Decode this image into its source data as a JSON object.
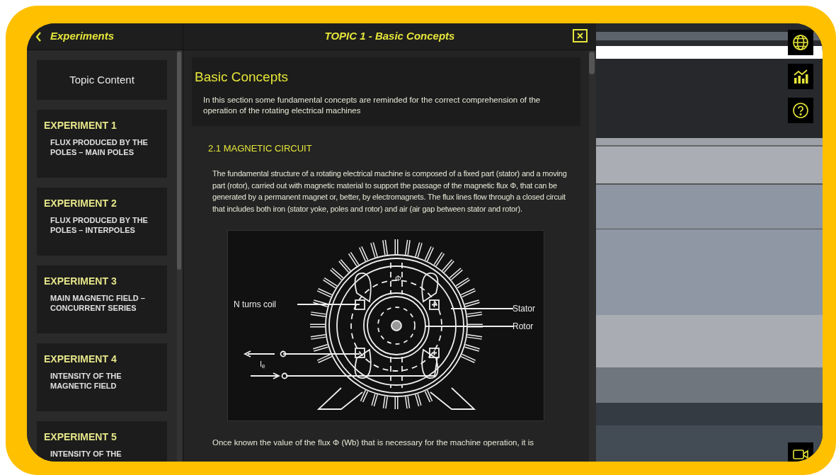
{
  "sidebar": {
    "back_label": "Experiments",
    "topic_content": "Topic Content",
    "items": [
      {
        "title": "EXPERIMENT 1",
        "subtitle": "FLUX PRODUCED BY THE POLES – MAIN POLES"
      },
      {
        "title": "EXPERIMENT 2",
        "subtitle": "FLUX PRODUCED BY THE POLES – INTERPOLES"
      },
      {
        "title": "EXPERIMENT 3",
        "subtitle": "MAIN MAGNETIC FIELD – CONCURRENT SERIES"
      },
      {
        "title": "EXPERIMENT 4",
        "subtitle": "INTENSITY OF THE MAGNETIC FIELD"
      },
      {
        "title": "EXPERIMENT 5",
        "subtitle": "INTENSITY OF THE"
      }
    ]
  },
  "panel": {
    "title": "TOPIC 1 - Basic Concepts",
    "heading": "Basic Concepts",
    "intro": "In this section some fundamental concepts are reminded for the correct comprehension of the operation of the rotating electrical machines",
    "section_title": "2.1 MAGNETIC CIRCUIT",
    "paragraph": "The fundamental structure of a rotating electrical machine is composed of a fixed part (stator) and a moving part (rotor), carried out with magnetic material to support the passage of the magnetic flux Φ, that can be generated by a permanent magnet or, better, by electromagnets. The flux lines flow through a closed circuit that includes both iron (stator yoke, poles and rotor) and air (air gap between stator and rotor).",
    "figure": {
      "coil_label": "N turns coil",
      "stator_label": "Stator",
      "rotor_label": "Rotor",
      "flux_label": "Φ",
      "current_label": "I$_{e}$"
    },
    "next_paragraph": "Once known the value of the flux Φ (Wb) that is necessary for the machine operation, it is"
  }
}
